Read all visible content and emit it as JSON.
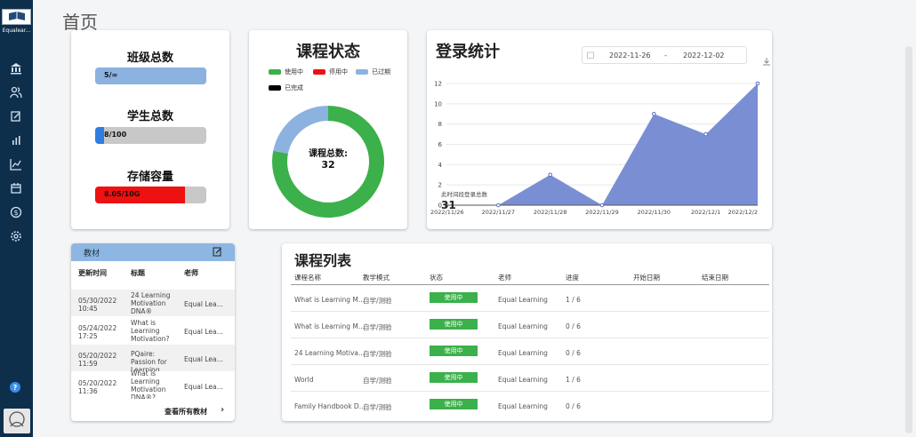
{
  "sidebar": {
    "logo_text": "Equalear...",
    "icons": [
      "bank-icon",
      "users-icon",
      "edit-doc-icon",
      "bar-chart-icon",
      "line-chart-icon",
      "calendar-icon",
      "dollar-icon",
      "gear-icon"
    ],
    "help_label": "?"
  },
  "page": {
    "title": "首页"
  },
  "stats": {
    "classes": {
      "title": "班级总数",
      "value": "5/∞",
      "fill": 1.0,
      "color": "#8cb2e0"
    },
    "students": {
      "title": "学生总数",
      "value": "8/100",
      "fill": 0.08,
      "color": "#2f7de1"
    },
    "storage": {
      "title": "存储容量",
      "value": "8.05/10G",
      "fill": 0.805,
      "color": "#ee1111"
    }
  },
  "course_status": {
    "title": "课程状态",
    "legend": [
      {
        "label": "使用中",
        "color": "#3cb04a"
      },
      {
        "label": "停用中",
        "color": "#ee1111"
      },
      {
        "label": "已过期",
        "color": "#8cb2e0"
      },
      {
        "label": "已完成",
        "color": "#000000"
      }
    ],
    "center_label": "课程总数:",
    "center_value": "32",
    "segments": [
      {
        "label": "使用中",
        "value": 25,
        "color": "#3cb04a"
      },
      {
        "label": "已过期",
        "value": 7,
        "color": "#8cb2e0"
      }
    ]
  },
  "login_stats": {
    "title": "登录统计",
    "date_start": "2022-11-26",
    "date_sep": "-",
    "date_end": "2022-12-02",
    "total_label": "此时间段登录总数",
    "total_value": "31"
  },
  "chart_data": {
    "type": "area",
    "categories": [
      "2022/11/26",
      "2022/11/27",
      "2022/11/28",
      "2022/11/29",
      "2022/11/30",
      "2022/12/1",
      "2022/12/2"
    ],
    "values": [
      0,
      0,
      3,
      0,
      9,
      7,
      12
    ],
    "yticks": [
      0,
      2,
      4,
      6,
      8,
      10,
      12
    ],
    "ylim": [
      0,
      12
    ],
    "xlabel": "",
    "ylabel": "",
    "color": "#7a8fd3",
    "grid": true
  },
  "materials": {
    "title": "教材",
    "columns": [
      "更新时间",
      "标题",
      "老师"
    ],
    "rows": [
      {
        "time": "05/30/2022 10:45",
        "title": "24 Learning Motivation DNA®",
        "teacher": "Equal Lea..."
      },
      {
        "time": "05/24/2022 17:25",
        "title": "What is Learning Motivation?",
        "teacher": "Equal Lea..."
      },
      {
        "time": "05/20/2022 11:59",
        "title": "PQaire: Passion for Learning",
        "teacher": "Equal Lea..."
      },
      {
        "time": "05/20/2022 11:36",
        "title": "What is Learning Motivation DNA®?",
        "teacher": "Equal Lea..."
      }
    ],
    "view_all": "查看所有教材",
    "chevron": "›"
  },
  "course_list": {
    "title": "课程列表",
    "columns": [
      "课程名称",
      "教学模式",
      "状态",
      "老师",
      "进度",
      "开始日期",
      "结束日期"
    ],
    "rows": [
      {
        "name": "What is Learning M...",
        "mode": "自学/测验",
        "status": "使用中",
        "teacher": "Equal Learning",
        "progress": "1 / 6",
        "start": "",
        "end": ""
      },
      {
        "name": "What is Learning M...",
        "mode": "自学/测验",
        "status": "使用中",
        "teacher": "Equal Learning",
        "progress": "0 / 6",
        "start": "",
        "end": ""
      },
      {
        "name": "24 Learning Motiva...",
        "mode": "自学/测验",
        "status": "使用中",
        "teacher": "Equal Learning",
        "progress": "0 / 6",
        "start": "",
        "end": ""
      },
      {
        "name": "World",
        "mode": "自学/测验",
        "status": "使用中",
        "teacher": "Equal Learning",
        "progress": "1 / 6",
        "start": "",
        "end": ""
      },
      {
        "name": "Family Handbook D...",
        "mode": "自学/测验",
        "status": "使用中",
        "teacher": "Equal Learning",
        "progress": "0 / 6",
        "start": "",
        "end": ""
      }
    ]
  }
}
